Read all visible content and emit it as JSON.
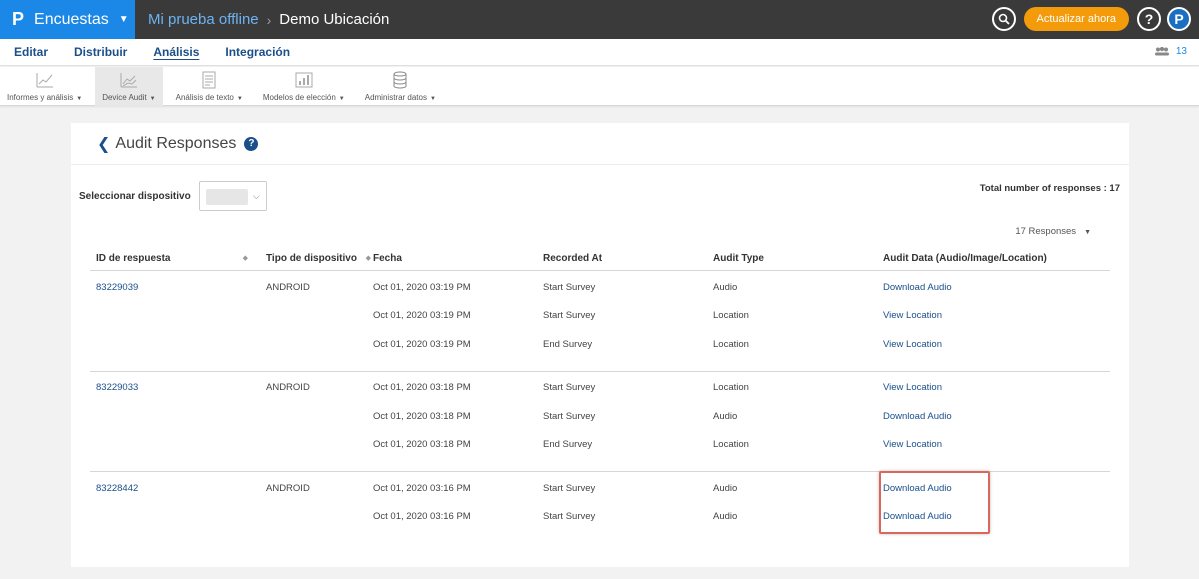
{
  "topbar": {
    "brand_logo": "P",
    "brand": "Encuestas",
    "caret": "▼",
    "crumb_link": "Mi prueba offline",
    "crumb_sep": "›",
    "crumb_current": "Demo Ubicación",
    "search_icon": "⚲",
    "upgrade_label": "Actualizar ahora",
    "help_label": "?",
    "profile_label": "P"
  },
  "menu": {
    "items": [
      "Editar",
      "Distribuir",
      "Análisis",
      "Integración"
    ],
    "users_icon": "👥",
    "users_count": "13"
  },
  "toolbar": {
    "items": [
      {
        "label": "Informes y análisis",
        "icon": "chart-icon"
      },
      {
        "label": "Device Audit",
        "icon": "device-audit-icon"
      },
      {
        "label": "Análisis de texto",
        "icon": "text-analysis-icon"
      },
      {
        "label": "Modelos de elección",
        "icon": "choice-model-icon"
      },
      {
        "label": "Administrar datos",
        "icon": "database-icon"
      }
    ],
    "caret": "▼"
  },
  "panel": {
    "back": "❮",
    "title": "Audit Responses",
    "help": "?",
    "filter_label": "Seleccionar dispositivo",
    "chevron": "⌵",
    "total": "Total number of responses : 17",
    "responses_dd": "17 Responses",
    "dd_caret": "▼"
  },
  "table": {
    "headers": [
      "ID de respuesta",
      "Tipo de dispositivo",
      "Fecha",
      "Recorded At",
      "Audit Type",
      "Audit Data (Audio/Image/Location)"
    ],
    "sort_icon": "◆",
    "groups": [
      {
        "id": "83229039",
        "device": "ANDROID",
        "rows": [
          {
            "date": "Oct 01, 2020 03:19 PM",
            "recorded": "Start Survey",
            "type": "Audio",
            "data": "Download Audio"
          },
          {
            "date": "Oct 01, 2020 03:19 PM",
            "recorded": "Start Survey",
            "type": "Location",
            "data": "View Location"
          },
          {
            "date": "Oct 01, 2020 03:19 PM",
            "recorded": "End Survey",
            "type": "Location",
            "data": "View Location"
          }
        ]
      },
      {
        "id": "83229033",
        "device": "ANDROID",
        "rows": [
          {
            "date": "Oct 01, 2020 03:18 PM",
            "recorded": "Start Survey",
            "type": "Location",
            "data": "View Location"
          },
          {
            "date": "Oct 01, 2020 03:18 PM",
            "recorded": "Start Survey",
            "type": "Audio",
            "data": "Download Audio"
          },
          {
            "date": "Oct 01, 2020 03:18 PM",
            "recorded": "End Survey",
            "type": "Location",
            "data": "View Location"
          }
        ]
      },
      {
        "id": "83228442",
        "device": "ANDROID",
        "rows": [
          {
            "date": "Oct 01, 2020 03:16 PM",
            "recorded": "Start Survey",
            "type": "Audio",
            "data": "Download Audio"
          },
          {
            "date": "Oct 01, 2020 03:16 PM",
            "recorded": "Start Survey",
            "type": "Audio",
            "data": "Download Audio"
          }
        ]
      }
    ]
  },
  "colors": {
    "brand": "#1b87e6",
    "topbar": "#3a3a3a",
    "upgrade": "#f39b0a",
    "link": "#1a4f8a",
    "highlight": "#d9685b"
  }
}
